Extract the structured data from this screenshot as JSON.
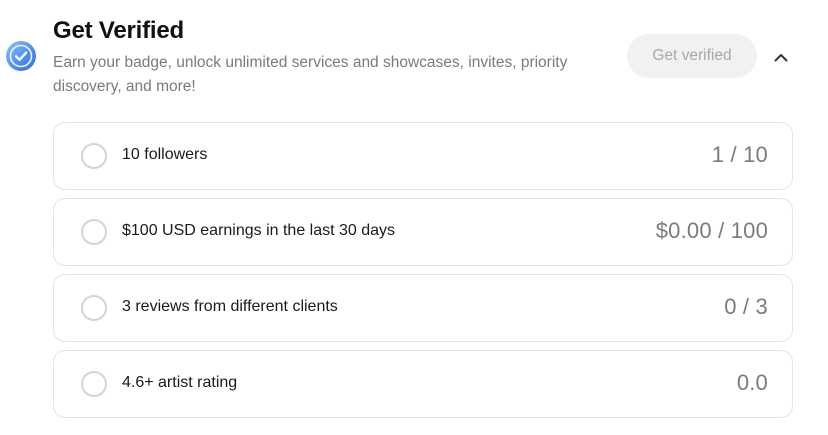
{
  "header": {
    "title": "Get Verified",
    "subtitle": "Earn your badge, unlock unlimited services and showcases, invites, priority discovery, and more!",
    "button_label": "Get verified",
    "icon": "verified-badge-icon",
    "toggle_icon": "chevron-up-icon"
  },
  "colors": {
    "accent": "#4f8ff0",
    "button_bg": "#f1f1f1",
    "button_text": "#a8a8a8"
  },
  "requirements": [
    {
      "label": "10 followers",
      "progress": "1 / 10"
    },
    {
      "label": "$100 USD earnings in the last 30 days",
      "progress": "$0.00 / 100"
    },
    {
      "label": "3 reviews from different clients",
      "progress": "0 / 3"
    },
    {
      "label": "4.6+ artist rating",
      "progress": "0.0"
    }
  ]
}
